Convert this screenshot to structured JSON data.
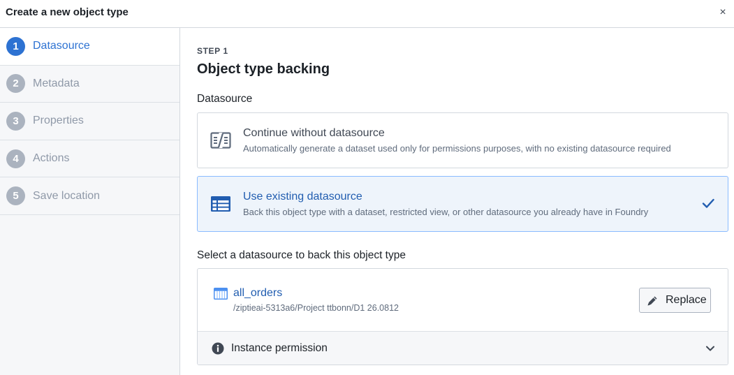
{
  "dialog": {
    "title": "Create a new object type",
    "close_glyph": "×"
  },
  "steps": [
    {
      "number": "1",
      "label": "Datasource",
      "active": true
    },
    {
      "number": "2",
      "label": "Metadata",
      "active": false
    },
    {
      "number": "3",
      "label": "Properties",
      "active": false
    },
    {
      "number": "4",
      "label": "Actions",
      "active": false
    },
    {
      "number": "5",
      "label": "Save location",
      "active": false
    }
  ],
  "main": {
    "eyebrow": "STEP 1",
    "title": "Object type backing",
    "datasource_label": "Datasource",
    "options": [
      {
        "icon": "columns-icon",
        "title": "Continue without datasource",
        "description": "Automatically generate a dataset used only for permissions purposes, with no existing datasource required",
        "selected": false
      },
      {
        "icon": "th-list-icon",
        "title": "Use existing datasource",
        "description": "Back this object type with a dataset, restricted view, or other datasource you already have in Foundry",
        "selected": true
      }
    ],
    "select_label": "Select a datasource to back this object type",
    "datasource": {
      "name": "all_orders",
      "path": "/ziptieai-5313a6/Project ttbonn/D1 26.0812",
      "replace_label": "Replace"
    },
    "permission": {
      "label": "Instance permission"
    }
  },
  "colors": {
    "accent": "#2d72d2",
    "accent_text": "#215db0",
    "selected_bg": "#eef4fb",
    "muted_step": "#abb3bf"
  }
}
